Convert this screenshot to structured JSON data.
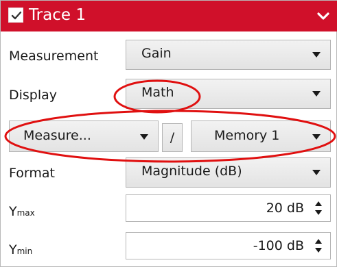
{
  "header": {
    "title": "Trace 1",
    "checkbox_checked": true,
    "collapse_icon": "chevron-down-icon",
    "background_color": "#d0102a"
  },
  "rows": {
    "measurement": {
      "label": "Measurement",
      "value": "Gain"
    },
    "display": {
      "label": "Display",
      "value": "Math"
    },
    "math": {
      "left_value": "Measure...",
      "operator": "/",
      "right_value": "Memory 1"
    },
    "format": {
      "label": "Format",
      "value": "Magnitude (dB)"
    },
    "ymax": {
      "label_main": "Y",
      "label_sub": "max",
      "value": "20 dB"
    },
    "ymin": {
      "label_main": "Y",
      "label_sub": "min",
      "value": "-100 dB"
    }
  },
  "annotations": {
    "highlight_color": "#e01010"
  }
}
